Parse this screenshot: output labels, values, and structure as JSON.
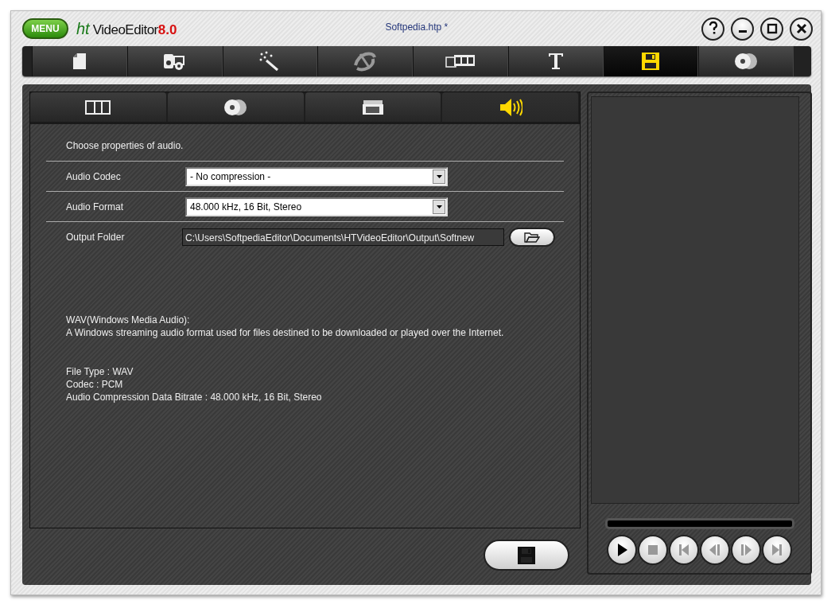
{
  "app": {
    "menu_button": "MENU",
    "logo_mark": "ht",
    "logo_name": "VideoEditor",
    "logo_version": "8.0"
  },
  "window": {
    "title": "Softpedia.htp *"
  },
  "window_buttons": [
    {
      "kind": "help"
    },
    {
      "kind": "minimize"
    },
    {
      "kind": "maximize"
    },
    {
      "kind": "close"
    }
  ],
  "toolbar": [
    {
      "kind": "new",
      "selected": false
    },
    {
      "kind": "capture",
      "selected": false
    },
    {
      "kind": "effects",
      "selected": false
    },
    {
      "kind": "transition",
      "selected": false
    },
    {
      "kind": "timeline",
      "selected": false
    },
    {
      "kind": "text",
      "selected": false
    },
    {
      "kind": "save",
      "selected": true
    },
    {
      "kind": "disc",
      "selected": false
    }
  ],
  "sub_tabs": [
    {
      "kind": "film",
      "selected": false
    },
    {
      "kind": "disc",
      "selected": false
    },
    {
      "kind": "camera",
      "selected": false
    },
    {
      "kind": "audio",
      "selected": true
    }
  ],
  "intro": "Choose properties of audio.",
  "fields": [
    {
      "kind": "dropdown",
      "label": "Audio Codec",
      "value": "- No compression -"
    },
    {
      "kind": "dropdown",
      "label": "Audio Format",
      "value": "48.000 kHz, 16 Bit, Stereo"
    },
    {
      "kind": "path",
      "label": "Output Folder",
      "value": "C:\\Users\\SoftpediaEditor\\Documents\\HTVideoEditor\\Output\\Softnew"
    }
  ],
  "description": {
    "title": "WAV(Windows Media Audio):",
    "text": "A Windows streaming audio format used for files destined to be downloaded or played over the Internet."
  },
  "details": [
    "File Type : WAV",
    "Codec : PCM",
    "Audio Compression Data Bitrate : 48.000 kHz, 16 Bit, Stereo"
  ],
  "player": {
    "controls": [
      {
        "kind": "play",
        "disabled": false
      },
      {
        "kind": "stop",
        "disabled": true
      },
      {
        "kind": "first",
        "disabled": true
      },
      {
        "kind": "step_back",
        "disabled": true
      },
      {
        "kind": "step_forward",
        "disabled": true
      },
      {
        "kind": "last",
        "disabled": true
      }
    ]
  }
}
